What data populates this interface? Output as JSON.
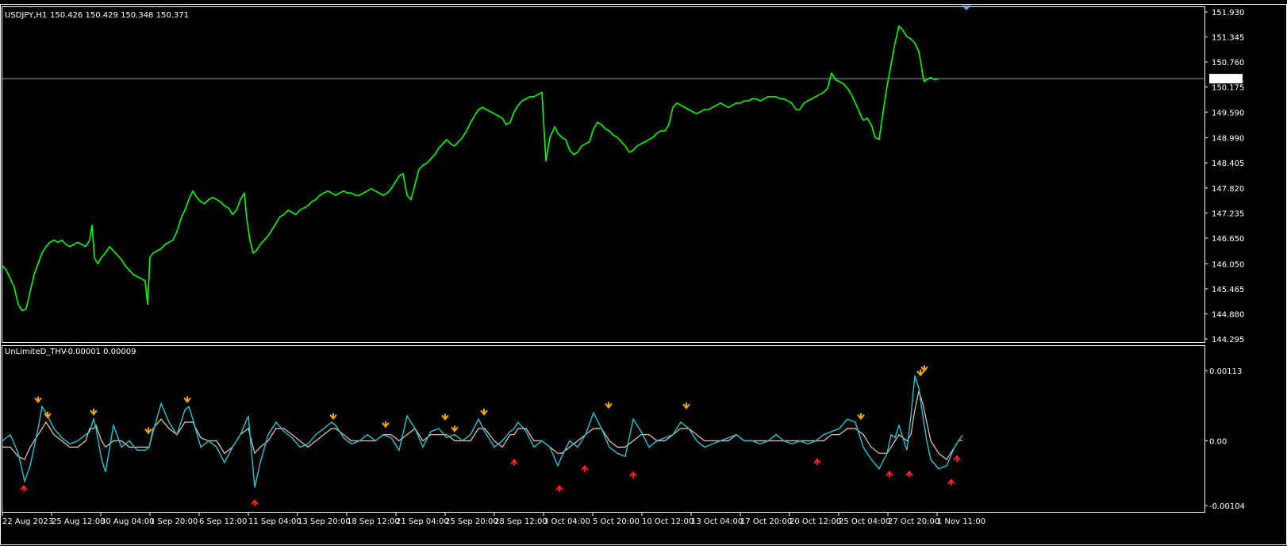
{
  "header": {
    "symbol_label": "USDJPY,H1",
    "ohlc_label": "150.426 150.429 150.348 150.371"
  },
  "indicator": {
    "label": "UnLimiteD_THV",
    "values_label": "-0.00001 0.00009"
  },
  "current_price_label": "150.371",
  "colors": {
    "background": "#000000",
    "frame": "#ffffff",
    "price_line": "#00ff00",
    "bid_line": "#8c9aa6",
    "fast_line": "#22c5d6",
    "slow_line": "#f2c6b8",
    "up_arrow": "#ffa500",
    "down_arrow": "#ff2020"
  },
  "chart_data": [
    {
      "type": "line",
      "series": [
        {
          "name": "USDJPY,H1",
          "color": "#00ff00"
        }
      ],
      "x_tick_labels": [
        "22 Aug 2023",
        "25 Aug 12:00",
        "30 Aug 04:00",
        "1 Sep 20:00",
        "6 Sep 12:00",
        "11 Sep 04:00",
        "13 Sep 20:00",
        "18 Sep 12:00",
        "21 Sep 04:00",
        "25 Sep 20:00",
        "28 Sep 12:00",
        "3 Oct 04:00",
        "5 Oct 20:00",
        "10 Oct 12:00",
        "13 Oct 04:00",
        "17 Oct 20:00",
        "20 Oct 12:00",
        "25 Oct 04:00",
        "27 Oct 20:00",
        "1 Nov 11:00"
      ],
      "y_tick_labels": [
        "151.930",
        "151.345",
        "150.760",
        "150.175",
        "149.590",
        "148.990",
        "148.405",
        "147.820",
        "147.235",
        "146.650",
        "146.050",
        "145.465",
        "144.880",
        "144.295"
      ],
      "ylim": [
        144.295,
        151.93
      ],
      "current_price": 150.371,
      "x": [
        0,
        5,
        10,
        15,
        20,
        25,
        30,
        35,
        40,
        45,
        50,
        55,
        60,
        65,
        70,
        75,
        80,
        85,
        90,
        95,
        100,
        105,
        110,
        113,
        116,
        120,
        125,
        130,
        135,
        140,
        145,
        150,
        155,
        160,
        165,
        170,
        175,
        180,
        183,
        186,
        190,
        195,
        200,
        205,
        210,
        215,
        220,
        225,
        230,
        235,
        240,
        245,
        250,
        255,
        260,
        265,
        270,
        275,
        280,
        285,
        290,
        295,
        300,
        305,
        308,
        312,
        316,
        320,
        325,
        330,
        335,
        340,
        345,
        350,
        355,
        360,
        365,
        370,
        375,
        380,
        385,
        390,
        395,
        400,
        405,
        410,
        415,
        420,
        425,
        430,
        435,
        440,
        445,
        450,
        455,
        460,
        465,
        470,
        475,
        480,
        485,
        490,
        495,
        500,
        505,
        510,
        515,
        520,
        525,
        530,
        535,
        540,
        545,
        550,
        555,
        560,
        565,
        570,
        575,
        580,
        585,
        590,
        595,
        600,
        605,
        610,
        615,
        620,
        625,
        630,
        635,
        640,
        645,
        650,
        655,
        660,
        665,
        670,
        675,
        680,
        685,
        690,
        695,
        696,
        700,
        705,
        710,
        715,
        720,
        725,
        730,
        735,
        740,
        745,
        750,
        755,
        760,
        765,
        770,
        775,
        780,
        785,
        790,
        795,
        800,
        805,
        810,
        815,
        820,
        825,
        830,
        835,
        840,
        845,
        850,
        855,
        860,
        865,
        870,
        875,
        880,
        885,
        890,
        895,
        900,
        905,
        910,
        915,
        920,
        925,
        930,
        935,
        940,
        945,
        950,
        955,
        960,
        965,
        970,
        975,
        980,
        985,
        990,
        995,
        1000,
        1005,
        1010,
        1015,
        1020,
        1025,
        1030,
        1035,
        1040,
        1045,
        1050,
        1055,
        1060,
        1065,
        1070,
        1075,
        1080,
        1083,
        1086,
        1090,
        1095,
        1100,
        1105,
        1110,
        1115,
        1120,
        1125,
        1130,
        1135,
        1140,
        1145,
        1150,
        1155,
        1158,
        1160,
        1162,
        1165,
        1170,
        1175,
        1180,
        1185,
        1190,
        1195,
        1200,
        1205,
        1210,
        1215
      ],
      "y": [
        146.0,
        145.9,
        145.7,
        145.5,
        145.1,
        144.95,
        145.0,
        145.4,
        145.8,
        146.05,
        146.3,
        146.45,
        146.55,
        146.6,
        146.55,
        146.6,
        146.5,
        146.45,
        146.5,
        146.55,
        146.5,
        146.45,
        146.6,
        146.95,
        146.2,
        146.05,
        146.2,
        146.3,
        146.45,
        146.35,
        146.25,
        146.15,
        146.0,
        145.9,
        145.8,
        145.75,
        145.7,
        145.65,
        145.1,
        146.2,
        146.3,
        146.35,
        146.4,
        146.5,
        146.55,
        146.6,
        146.8,
        147.1,
        147.3,
        147.55,
        147.75,
        147.6,
        147.5,
        147.45,
        147.55,
        147.6,
        147.55,
        147.5,
        147.4,
        147.35,
        147.2,
        147.3,
        147.55,
        147.7,
        147.1,
        146.6,
        146.3,
        146.35,
        146.5,
        146.6,
        146.7,
        146.85,
        147.0,
        147.15,
        147.2,
        147.3,
        147.25,
        147.2,
        147.3,
        147.35,
        147.4,
        147.5,
        147.55,
        147.65,
        147.7,
        147.75,
        147.7,
        147.65,
        147.7,
        147.75,
        147.7,
        147.7,
        147.65,
        147.65,
        147.7,
        147.75,
        147.8,
        147.75,
        147.7,
        147.65,
        147.7,
        147.8,
        147.95,
        148.1,
        148.15,
        147.65,
        147.55,
        147.9,
        148.25,
        148.35,
        148.4,
        148.5,
        148.6,
        148.75,
        148.85,
        148.95,
        148.85,
        148.8,
        148.9,
        149.0,
        149.15,
        149.35,
        149.5,
        149.65,
        149.7,
        149.65,
        149.6,
        149.55,
        149.5,
        149.45,
        149.3,
        149.35,
        149.6,
        149.75,
        149.85,
        149.9,
        149.95,
        149.95,
        150.0,
        150.05,
        148.45,
        149.0,
        149.2,
        149.25,
        149.1,
        149.0,
        148.95,
        148.7,
        148.6,
        148.65,
        148.8,
        148.85,
        148.9,
        149.2,
        149.35,
        149.3,
        149.2,
        149.15,
        149.05,
        149.0,
        148.9,
        148.8,
        148.65,
        148.7,
        148.8,
        148.85,
        148.9,
        148.95,
        149.0,
        149.1,
        149.15,
        149.15,
        149.3,
        149.7,
        149.8,
        149.75,
        149.7,
        149.65,
        149.6,
        149.55,
        149.6,
        149.65,
        149.65,
        149.7,
        149.75,
        149.8,
        149.75,
        149.7,
        149.75,
        149.8,
        149.8,
        149.85,
        149.85,
        149.9,
        149.9,
        149.85,
        149.9,
        149.95,
        149.95,
        149.95,
        149.9,
        149.9,
        149.85,
        149.8,
        149.65,
        149.65,
        149.8,
        149.85,
        149.9,
        149.95,
        150.0,
        150.05,
        150.15,
        150.5,
        150.35,
        150.3,
        150.25,
        150.15,
        150.0,
        149.8,
        149.6,
        149.45,
        149.4,
        149.45,
        149.3,
        149.0,
        148.95,
        149.6,
        150.2,
        150.7,
        151.2,
        151.6,
        151.5,
        151.35,
        151.3,
        151.2,
        151.0,
        150.7,
        150.45,
        150.3,
        150.35,
        150.4,
        150.35,
        150.371
      ]
    },
    {
      "type": "line",
      "series": [
        {
          "name": "UnLimiteD_THV fast",
          "color": "#22c5d6"
        },
        {
          "name": "UnLimiteD_THV slow",
          "color": "#f2c6b8"
        }
      ],
      "y_tick_labels": [
        "0.00113",
        "0.00",
        "-0.00104"
      ],
      "ylim": [
        -0.00104,
        0.00113
      ],
      "x": [
        0,
        10,
        20,
        28,
        35,
        45,
        50,
        55,
        65,
        75,
        85,
        95,
        105,
        110,
        115,
        118,
        125,
        130,
        140,
        150,
        160,
        170,
        180,
        185,
        190,
        200,
        210,
        220,
        230,
        235,
        240,
        250,
        260,
        270,
        280,
        290,
        300,
        310,
        318,
        325,
        335,
        345,
        355,
        365,
        375,
        385,
        395,
        405,
        415,
        420,
        430,
        440,
        450,
        460,
        470,
        480,
        490,
        500,
        510,
        520,
        530,
        540,
        550,
        560,
        570,
        580,
        590,
        600,
        608,
        620,
        630,
        640,
        645,
        650,
        660,
        670,
        680,
        690,
        700,
        705,
        715,
        725,
        735,
        745,
        755,
        765,
        775,
        785,
        795,
        805,
        815,
        825,
        835,
        845,
        855,
        865,
        875,
        885,
        895,
        905,
        915,
        925,
        935,
        945,
        955,
        965,
        975,
        985,
        995,
        1005,
        1015,
        1025,
        1035,
        1045,
        1055,
        1065,
        1075,
        1085,
        1095,
        1105,
        1115,
        1120,
        1125,
        1130,
        1140,
        1145,
        1150,
        1155,
        1160,
        1165,
        1170,
        1180,
        1190,
        1195,
        1200,
        1205,
        1210,
        1215
      ],
      "fast": [
        0.0,
        0.0001,
        -0.0002,
        -0.00065,
        -0.0004,
        0.0002,
        0.00055,
        0.00045,
        0.0002,
        5e-05,
        -5e-05,
        -0.0,
        0.0001,
        0.00015,
        0.00035,
        0.0002,
        -0.0003,
        -0.0005,
        0.00025,
        -0.0001,
        0.0,
        -0.00015,
        -0.00015,
        -0.0001,
        0.00015,
        0.0006,
        0.0003,
        0.0001,
        0.0005,
        0.00055,
        0.00035,
        -0.0001,
        0.0,
        -0.0001,
        -0.00035,
        -0.0001,
        0.0001,
        0.0004,
        -0.00075,
        -0.00035,
        0.0001,
        0.0003,
        0.00015,
        5e-05,
        -0.0001,
        -5e-05,
        0.0001,
        0.0002,
        0.0003,
        0.00025,
        5e-05,
        -5e-05,
        0.0,
        0.0001,
        0.0,
        0.0001,
        5e-05,
        -0.00015,
        0.0004,
        0.0002,
        -0.0001,
        0.00015,
        0.0002,
        5e-05,
        0.0001,
        0.0,
        0.0001,
        0.00035,
        0.00015,
        -0.0001,
        0.0,
        0.00015,
        0.0002,
        0.0003,
        0.00015,
        -0.0001,
        0.0,
        -0.0001,
        -0.0004,
        -0.00025,
        -0.0,
        -0.0001,
        0.0001,
        0.00045,
        0.0002,
        -0.0001,
        -0.0002,
        -0.00025,
        0.00035,
        0.00015,
        -0.0001,
        0.0,
        5e-05,
        0.0001,
        0.0003,
        0.0002,
        0.0,
        -0.0001,
        -5e-05,
        0.0,
        5e-05,
        0.0001,
        0.0,
        0.0,
        -5e-05,
        0.0,
        0.0001,
        0.0,
        -5e-05,
        0.0,
        -5e-05,
        0.0,
        0.0001,
        0.00015,
        0.0002,
        0.00035,
        0.0003,
        -0.0001,
        -0.0003,
        -0.00045,
        -0.0002,
        0.0001,
        5e-05,
        0.00025,
        -0.00015,
        0.0004,
        0.00105,
        0.00085,
        0.0004,
        0.0,
        -0.0003,
        -0.00045,
        -0.0004,
        -0.00025,
        -0.0001,
        0.0,
        9e-05
      ],
      "slow": [
        -0.0001,
        -0.0001,
        -0.00025,
        -0.0003,
        -0.0001,
        0.0001,
        0.0002,
        0.0003,
        0.0001,
        0.0,
        -0.0001,
        -0.0001,
        0.0,
        0.0002,
        0.0002,
        0.00025,
        0.0,
        -0.0001,
        0.0,
        0.0,
        -0.0001,
        -0.0001,
        -0.0001,
        -0.0001,
        0.0002,
        0.00035,
        0.0002,
        0.0001,
        0.0003,
        0.0003,
        0.0003,
        5e-05,
        0.0,
        0.0,
        -0.0002,
        -0.0001,
        0.0001,
        0.0002,
        -0.0002,
        -0.0001,
        0.0,
        0.0002,
        0.0002,
        0.0001,
        0.0,
        -0.0001,
        0.0,
        0.0001,
        0.0002,
        0.0002,
        0.0001,
        0.0,
        0.0,
        0.0,
        0.0,
        0.0001,
        0.0001,
        0.0,
        0.0001,
        0.0002,
        0.0,
        0.0001,
        0.0001,
        0.0001,
        0.0,
        0.0,
        0.0,
        0.0002,
        0.0002,
        0.0,
        -0.0001,
        0.0001,
        0.0001,
        0.0002,
        0.0002,
        0.0,
        0.0,
        -0.0001,
        -0.0002,
        -0.0002,
        -0.0001,
        0.0,
        0.0001,
        0.0002,
        0.0002,
        0.0,
        -0.0001,
        -0.0001,
        0.0,
        0.0001,
        0.0001,
        0.0,
        0.0,
        0.0001,
        0.0002,
        0.0002,
        0.0001,
        0.0,
        0.0,
        0.0,
        0.0,
        0.0001,
        0.0,
        0.0,
        0.0,
        0.0,
        0.0,
        0.0,
        0.0,
        0.0,
        0.0,
        0.0,
        0.0,
        0.0001,
        0.0001,
        0.0002,
        0.0002,
        0.0001,
        -0.0001,
        -0.0002,
        -0.0002,
        -0.0001,
        0.0,
        0.0001,
        0.0,
        0.0001,
        0.0005,
        0.0008,
        0.0006,
        0.0003,
        0.0,
        -0.0002,
        -0.0003,
        -0.0002,
        -0.0001,
        0.0,
        1e-05
      ],
      "up_arrows": [
        [
          45,
          0.00055
        ],
        [
          57,
          0.0003
        ],
        [
          115,
          0.00035
        ],
        [
          184,
          5e-05
        ],
        [
          233,
          0.00055
        ],
        [
          417,
          0.00028
        ],
        [
          483,
          0.00015
        ],
        [
          558,
          0.00027
        ],
        [
          570,
          8e-05
        ],
        [
          607,
          0.00035
        ],
        [
          764,
          0.00046
        ],
        [
          862,
          0.00045
        ],
        [
          1082,
          0.00028
        ],
        [
          1157,
          0.00098
        ],
        [
          1162,
          0.00105
        ]
      ],
      "down_arrows": [
        [
          27,
          -0.00065
        ],
        [
          318,
          -0.00088
        ],
        [
          645,
          -0.00023
        ],
        [
          702,
          -0.00065
        ],
        [
          734,
          -0.00033
        ],
        [
          795,
          -0.00043
        ],
        [
          1027,
          -0.00022
        ],
        [
          1118,
          -0.00042
        ],
        [
          1143,
          -0.00042
        ],
        [
          1196,
          -0.00055
        ],
        [
          1203,
          -0.00017
        ]
      ]
    }
  ]
}
